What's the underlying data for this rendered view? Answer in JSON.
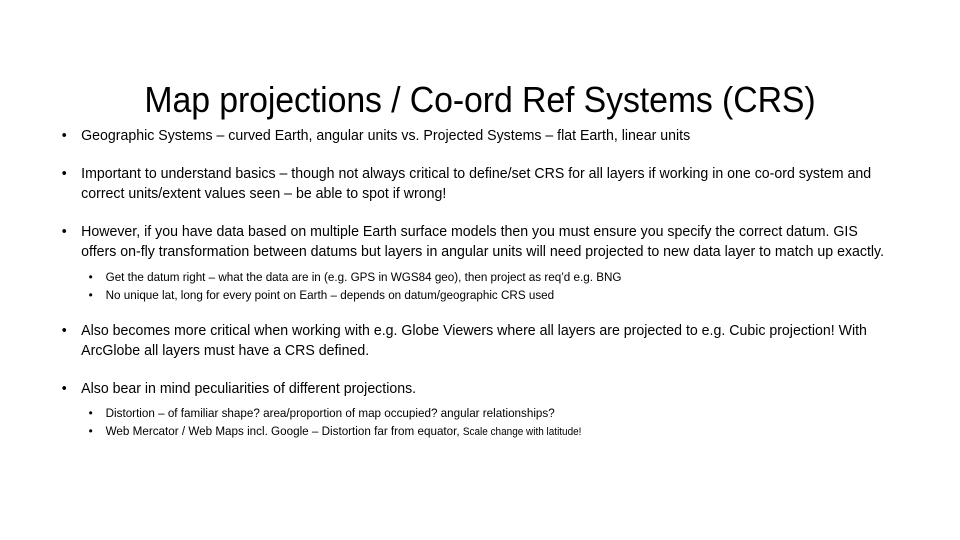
{
  "slide": {
    "title": "Map projections / Co-ord Ref Systems (CRS)",
    "bullet_glyph": "•",
    "background_color": "#ffffff",
    "text_color": "#000000",
    "bullets": [
      {
        "level": 1,
        "text": "Geographic Systems – curved Earth, angular units vs. Projected Systems – flat Earth, linear units"
      },
      {
        "level": 1,
        "text": "Important to understand basics – though not always critical to define/set CRS for all layers if working in one co-ord system and correct units/extent values seen – be able to spot if wrong!"
      },
      {
        "level": 1,
        "text": "However, if you have data based on multiple Earth surface models then you must ensure you specify the correct datum.  GIS offers on-fly transformation between datums but layers in angular units will need projected to new data layer to match up exactly."
      },
      {
        "level": 2,
        "text": "Get the datum right – what the data are in (e.g. GPS in WGS84 geo), then project as req’d e.g. BNG"
      },
      {
        "level": 2,
        "text": "No unique lat, long for every point on Earth – depends on datum/geographic CRS used"
      },
      {
        "level": 1,
        "text": "Also becomes more critical when working with e.g. Globe Viewers where all layers are projected to e.g. Cubic projection!  With ArcGlobe all layers must have a CRS defined."
      },
      {
        "level": 1,
        "text": "Also bear in mind peculiarities of different projections."
      },
      {
        "level": 2,
        "text": "Distortion – of familiar shape? area/proportion of map occupied? angular relationships?"
      },
      {
        "level": 2,
        "text_main": "Web Mercator / Web Maps incl. Google – Distortion far from equator, ",
        "text_small": "Scale change with latitude!"
      }
    ]
  }
}
